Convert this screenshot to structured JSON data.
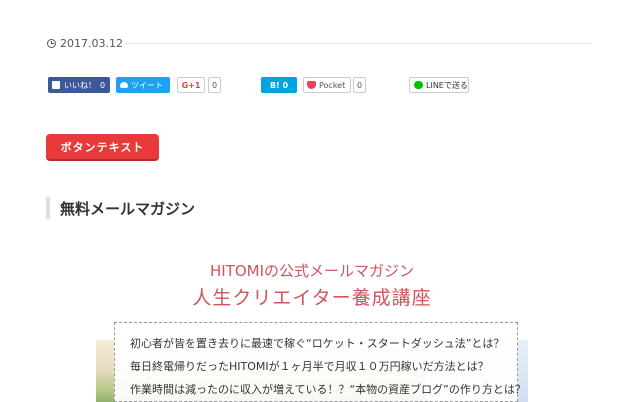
{
  "post": {
    "date": "2017.03.12"
  },
  "share": {
    "facebook": {
      "label": "いいね！",
      "count": "0"
    },
    "twitter": {
      "label": "ツイート"
    },
    "googleplus": {
      "label": "G+1",
      "count": "0"
    },
    "hatena": {
      "label": "B! 0"
    },
    "pocket": {
      "label": "Pocket",
      "count": "0"
    },
    "line": {
      "label": "LINEで送る"
    }
  },
  "button": {
    "label": "ボタンテキスト"
  },
  "section": {
    "heading": "無料メールマガジン"
  },
  "banner": {
    "title_line1": "HITOMIの公式メールマガジン",
    "title_line2": "人生クリエイター養成講座",
    "questions": [
      "初心者が皆を置き去りに最速で稼ぐ“ロケット・スタートダッシュ法”とは？",
      "毎日終電帰りだったHITOMIが１ヶ月半で月収１０万円稼いだ方法とは？",
      "作業時間は減ったのに収入が増えている！？“本物の資産ブログ”の作り方とは？"
    ]
  },
  "colors": {
    "accent_red": "#e83a3a",
    "banner_title": "#d0555e",
    "facebook": "#3b5998",
    "twitter": "#1da1f2",
    "hatena": "#00a4de",
    "line": "#00c300"
  }
}
